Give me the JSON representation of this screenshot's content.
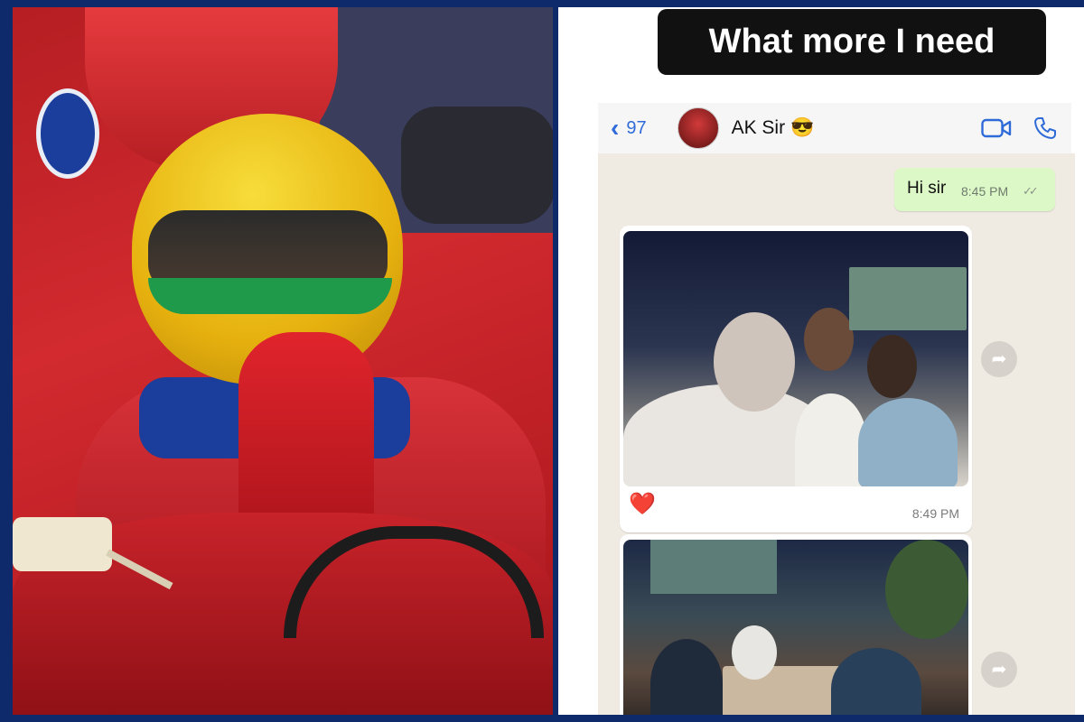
{
  "story": {
    "caption": "What more I need"
  },
  "chat_header": {
    "back_count": "97",
    "contact_name": "AK Sir",
    "contact_emoji": "😎",
    "accent_color": "#2f6bd8"
  },
  "messages": [
    {
      "direction": "outgoing",
      "text": "Hi sir",
      "time": "8:45 PM",
      "status": "read"
    },
    {
      "direction": "incoming",
      "type": "photo",
      "reaction": "❤️",
      "time": "8:49 PM"
    },
    {
      "direction": "incoming",
      "type": "photo"
    }
  ],
  "icons": {
    "back": "chevron-left-icon",
    "video_call": "video-camera-icon",
    "voice_call": "phone-icon",
    "forward": "forward-icon"
  }
}
